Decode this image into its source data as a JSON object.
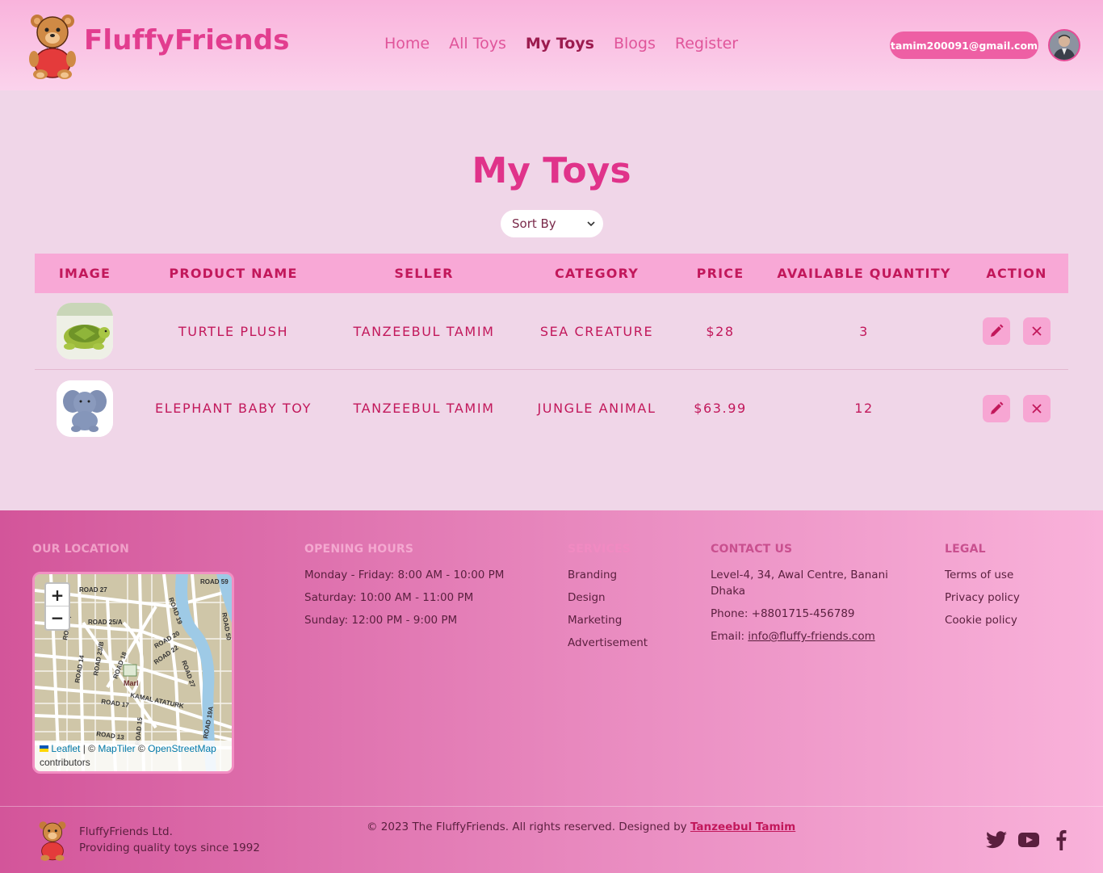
{
  "header": {
    "brand": "FluffyFriends",
    "nav": [
      "Home",
      "All Toys",
      "My Toys",
      "Blogs",
      "Register"
    ],
    "active_nav": "My Toys",
    "user_email": "tamim200091@gmail.com"
  },
  "main": {
    "title": "My Toys",
    "sort": {
      "selected": "Sort By"
    },
    "table": {
      "columns": [
        "IMAGE",
        "PRODUCT NAME",
        "SELLER",
        "CATEGORY",
        "PRICE",
        "AVAILABLE QUANTITY",
        "ACTION"
      ],
      "rows": [
        {
          "name": "TURTLE PLUSH",
          "seller": "TANZEEBUL TAMIM",
          "category": "SEA CREATURE",
          "price": "$28",
          "quantity": "3",
          "image_icon": "turtle-plush-icon"
        },
        {
          "name": "ELEPHANT BABY TOY",
          "seller": "TANZEEBUL TAMIM",
          "category": "JUNGLE ANIMAL",
          "price": "$63.99",
          "quantity": "12",
          "image_icon": "elephant-plush-icon"
        }
      ]
    }
  },
  "footer": {
    "location": {
      "heading": "OUR LOCATION",
      "map": {
        "zoom_in": "+",
        "zoom_out": "−",
        "attribution": {
          "leaflet": "Leaflet",
          "sep1": " | © ",
          "maptiler": "MapTiler",
          "sep2": " © ",
          "osm": "OpenStreetMap",
          "tail": "contributors"
        },
        "labels": [
          "ROAD 27",
          "ROAD 59",
          "ROAD 25/A",
          "ROAD 4",
          "ROAD 19",
          "ROAD 20",
          "ROAD 50",
          "ROAD 23/B",
          "ROAD 14",
          "ROAD 18",
          "ROAD 22",
          "ROAD 27",
          "KAMAL ATATURK",
          "ROAD 17",
          "ROAD 13",
          "ROAD 15",
          "ROAD 19A",
          "Marl"
        ]
      }
    },
    "hours": {
      "heading": "OPENING HOURS",
      "items": [
        "Monday - Friday: 8:00 AM - 10:00 PM",
        "Saturday: 10:00 AM - 11:00 PM",
        "Sunday: 12:00 PM - 9:00 PM"
      ]
    },
    "services": {
      "heading": "SERVICES",
      "items": [
        "Branding",
        "Design",
        "Marketing",
        "Advertisement"
      ]
    },
    "contact": {
      "heading": "CONTACT US",
      "address": "Level-4, 34, Awal Centre, Banani Dhaka",
      "phone": "Phone: +8801715-456789",
      "email_prefix": "Email: ",
      "email": "info@fluffy-friends.com"
    },
    "legal": {
      "heading": "LEGAL",
      "items": [
        "Terms of use",
        "Privacy policy",
        "Cookie policy"
      ]
    },
    "company": {
      "name": "FluffyFriends Ltd.",
      "tagline": "Providing quality toys since 1992"
    },
    "copyright": {
      "text": "© 2023 The FluffyFriends. All rights reserved. Designed by ",
      "designer": "Tanzeebul Tamim"
    },
    "social": [
      "twitter-icon",
      "youtube-icon",
      "facebook-icon"
    ]
  },
  "colors": {
    "brand_pink": "#e23d8f",
    "nav_active": "#9c1c4f",
    "table_header": "#f8a8d6",
    "text_pink": "#c2185b",
    "footer_heading_muted": "#f0a0c8"
  }
}
